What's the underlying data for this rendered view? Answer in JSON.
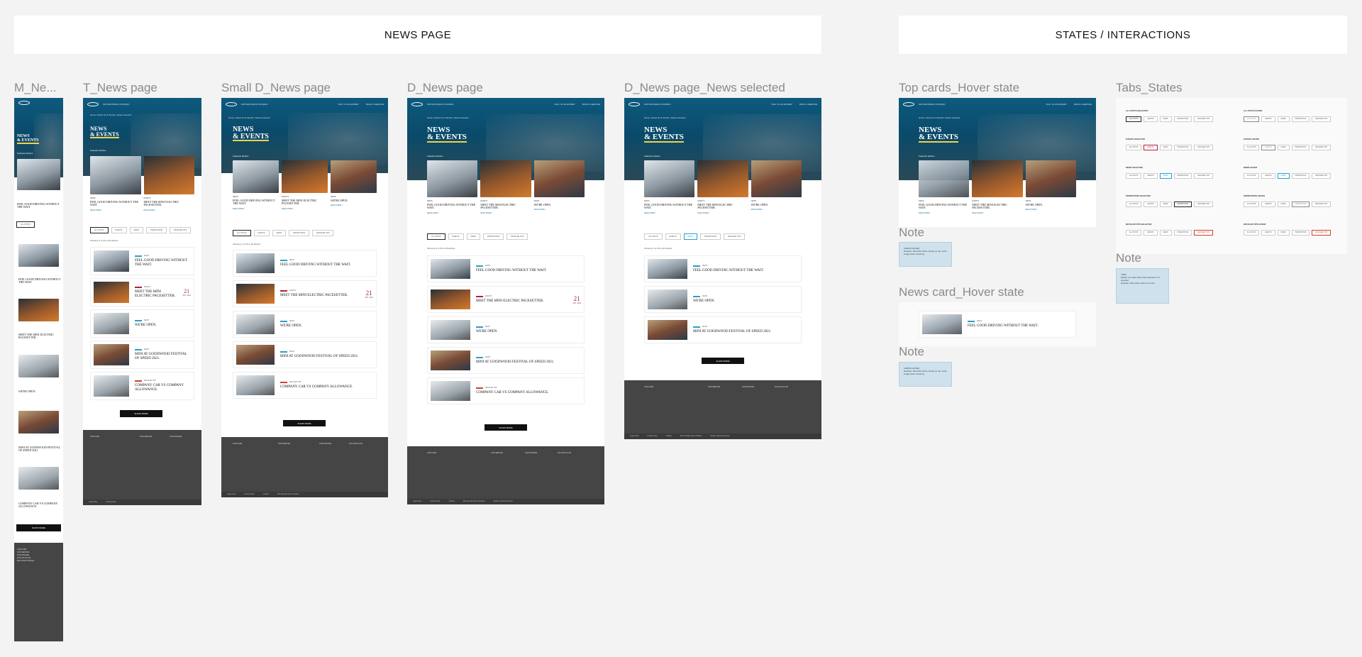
{
  "banners": {
    "news_page": "NEWS PAGE",
    "states": "STATES / INTERACTIONS"
  },
  "frame_labels": {
    "mobile": "M_Ne...",
    "tablet": "T_News page",
    "small_desktop": "Small D_News page",
    "desktop": "D_News page",
    "desktop_selected": "D_News page_News selected",
    "top_cards_hover": "Top cards_Hover state",
    "tabs_states": "Tabs_States",
    "news_card_hover": "News card_Hover state"
  },
  "note_labels": {
    "note1": "Note",
    "note2": "Note",
    "note3": "Note"
  },
  "hero": {
    "title_line1": "NEWS",
    "title_line2": "& EVENTS",
    "featured": "Featured articles",
    "crumbs": "Home  /  About Us & Stories  /  News & Events",
    "nav_brand": "MOTOR-WORLD ONTARIO",
    "nav_link1": "TALK TO AN EXPERT",
    "nav_link2": "BOOK A SERVICE"
  },
  "top_cards": [
    {
      "cat": "NEWS",
      "title": "FEEL GOOD DRIVING WITHOUT THE WAIT.",
      "link": "READ MORE  >"
    },
    {
      "cat": "EVENTS",
      "title": "MEET THE MINI ELECTRIC PACESETTER.",
      "link": "READ MORE  >"
    },
    {
      "cat": "NEWS",
      "title": "WE'RE OPEN.",
      "link": "READ MORE  >"
    }
  ],
  "tabs": [
    "ALL POSTS",
    "EVENTS",
    "NEWS",
    "PROMOTIONS",
    "RETAILER TIPS"
  ],
  "showing": "Showing 1 to 06 of 18 articles",
  "articles": [
    {
      "tag": "NEWS",
      "color": "#2aa0c8",
      "title": "FEEL GOOD DRIVING WITHOUT THE WAIT."
    },
    {
      "tag": "EVENTS",
      "color": "#b0203a",
      "title": "MEET THE MINI ELECTRIC PACESETTER.",
      "day": "21",
      "month": "JUN, 2021"
    },
    {
      "tag": "NEWS",
      "color": "#2aa0c8",
      "title": "WE'RE OPEN."
    },
    {
      "tag": "NEWS",
      "color": "#2aa0c8",
      "title": "MINI AT GOODWOOD FESTIVAL OF SPEED 2021."
    },
    {
      "tag": "RETAILER TIPS",
      "color": "#d0402a",
      "title": "COMPANY CAR VS COMPANY ALLOWANCE."
    }
  ],
  "show_more": "SHOW MORE",
  "footer": {
    "col1": "OUR CARS",
    "col2": "OUR SERVICE",
    "col3": "OUR FINANCE",
    "col4": "FOLLOW US ON",
    "dealer": "MINI ONE OF REGAL",
    "bar": [
      "Legal notice",
      "Privacy Policy",
      "Cookies",
      "Mini Canada Code of Practice",
      "Retailer Operated Account"
    ]
  },
  "notes": {
    "n1": "CARDS HOVER\nDesktop: Add 10% white overlay on top of the image when hovering.",
    "n2": "CARDS HOVER\nDesktop: Add 10% white overlay on top of the image when hovering.",
    "n3": "TABS\nMobile: No state other than selected / not selected\nDesktop: Add outline when on hover"
  },
  "tab_states": [
    {
      "caption": "ALL POSTS SELECTED",
      "sel": 0,
      "color": "#222"
    },
    {
      "caption": "ALL POSTS HOVER",
      "sel": 0,
      "color": "#888"
    },
    {
      "caption": "EVENTS SELECTED",
      "sel": 1,
      "color": "#b0203a"
    },
    {
      "caption": "EVENTS HOVER",
      "sel": 1,
      "color": "#888"
    },
    {
      "caption": "NEWS SELECTED",
      "sel": 2,
      "color": "#2aa0c8"
    },
    {
      "caption": "NEWS HOVER",
      "sel": 2,
      "color": "#2aa0c8"
    },
    {
      "caption": "PROMOTIONS SELECTED",
      "sel": 3,
      "color": "#222"
    },
    {
      "caption": "PROMOTIONS HOVER",
      "sel": 3,
      "color": "#888"
    },
    {
      "caption": "RETAILER TIPS SELECTED",
      "sel": 4,
      "color": "#d0402a"
    },
    {
      "caption": "RETAILER TIPS HOVER",
      "sel": 4,
      "color": "#d0402a"
    }
  ]
}
